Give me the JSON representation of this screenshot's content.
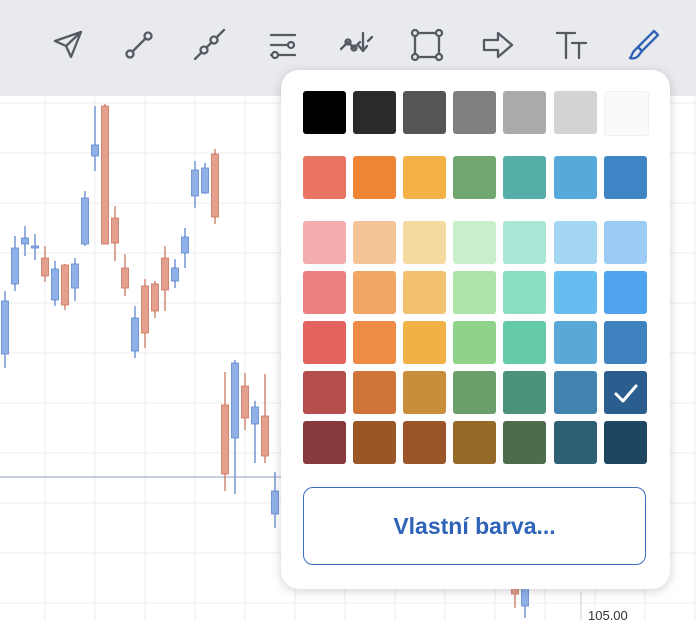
{
  "toolbar": {
    "tools": [
      {
        "name": "cursor-arrow-icon",
        "active": false
      },
      {
        "name": "trend-line-icon",
        "active": false
      },
      {
        "name": "ray-line-icon",
        "active": false
      },
      {
        "name": "parallel-channel-icon",
        "active": false
      },
      {
        "name": "pattern-icon",
        "active": false
      },
      {
        "name": "rectangle-icon",
        "active": false
      },
      {
        "name": "arrow-right-icon",
        "active": false
      },
      {
        "name": "text-icon",
        "active": false
      },
      {
        "name": "brush-icon",
        "active": true
      }
    ],
    "icon_color": "#555a62",
    "active_color": "#2f63b8"
  },
  "chart": {
    "price_label": "105.00",
    "up_color": "#8fb1e8",
    "down_color": "#e5a08d"
  },
  "color_picker": {
    "rows": [
      [
        "#000000",
        "#2b2b2b",
        "#555555",
        "#808080",
        "#aaaaaa",
        "#d3d3d3",
        "#fafafa"
      ],
      [
        "#e97461",
        "#ee8535",
        "#f4b146",
        "#70a870",
        "#56aea8",
        "#56a9d8",
        "#3f84c4"
      ],
      [
        "#f3adad",
        "#f5c496",
        "#f4d9a1",
        "#c9efca",
        "#a9e6d6",
        "#a4d7f3",
        "#9ccbf6"
      ],
      [
        "#ee7f7f",
        "#f1a664",
        "#f2c270",
        "#ace3a6",
        "#88ddc3",
        "#66bef0",
        "#4fa3ef"
      ],
      [
        "#e3645f",
        "#ee8c46",
        "#f2b147",
        "#8fd38b",
        "#64cba6",
        "#5aa8d7",
        "#3f82c0"
      ],
      [
        "#b44f4c",
        "#cf753a",
        "#c98e3c",
        "#6a9e6a",
        "#4a9378",
        "#4383b0",
        "#2b5d8f"
      ],
      [
        "#88393b",
        "#9b5628",
        "#9a5629",
        "#956a28",
        "#4c6d4b",
        "#2e5f73",
        "#1f4661"
      ]
    ],
    "selected": "#2b5d8f",
    "custom_button_label": "Vlastní barva..."
  }
}
